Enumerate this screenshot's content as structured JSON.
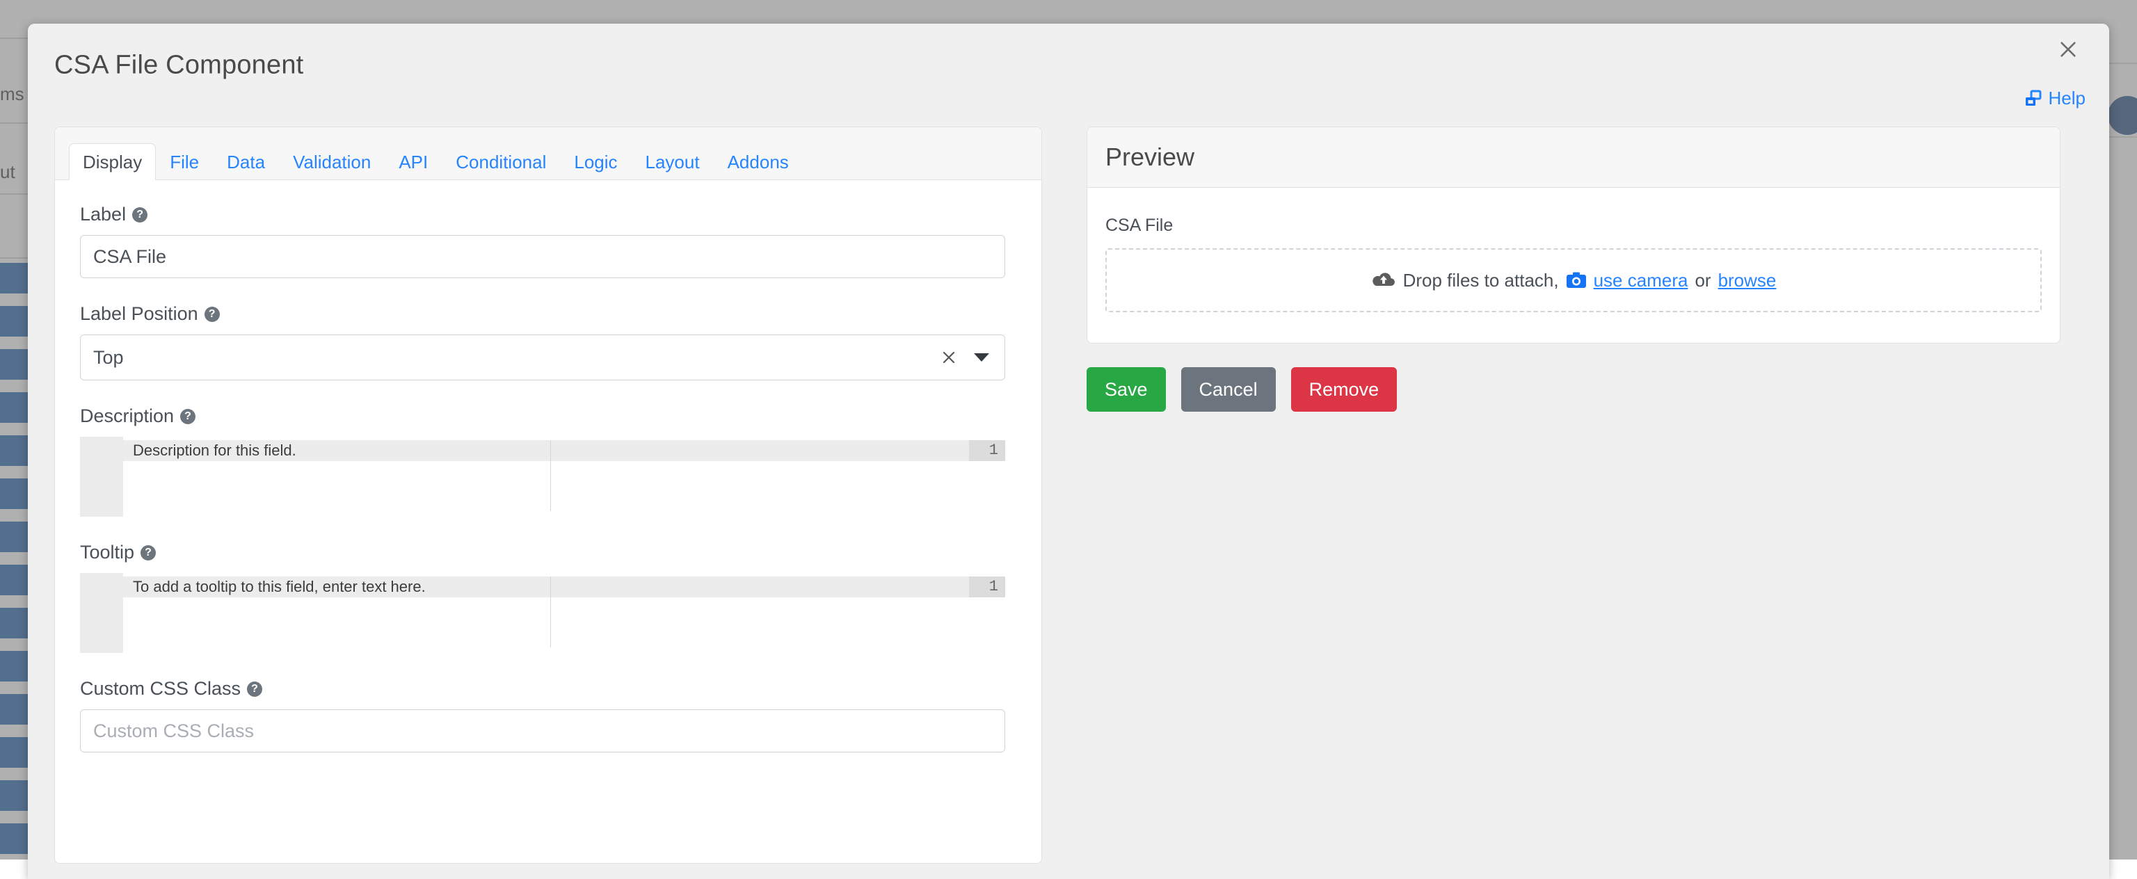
{
  "background": {
    "labels": [
      "ms",
      "ut"
    ],
    "blue_block_count": 9,
    "fab_icon": "circle-fab-icon"
  },
  "modal": {
    "title": "CSA File Component",
    "close_icon": "close-icon",
    "help": {
      "label": "Help",
      "icon": "help-windows-icon",
      "color": "#2684ff"
    }
  },
  "tabs": [
    {
      "label": "Display",
      "active": true
    },
    {
      "label": "File",
      "active": false
    },
    {
      "label": "Data",
      "active": false
    },
    {
      "label": "Validation",
      "active": false
    },
    {
      "label": "API",
      "active": false
    },
    {
      "label": "Conditional",
      "active": false
    },
    {
      "label": "Logic",
      "active": false
    },
    {
      "label": "Layout",
      "active": false
    },
    {
      "label": "Addons",
      "active": false
    }
  ],
  "form": {
    "label_field": {
      "label": "Label",
      "help_icon": "question-mark-icon",
      "value": "CSA File",
      "placeholder": "Label"
    },
    "label_position_field": {
      "label": "Label Position",
      "help_icon": "question-mark-icon",
      "value": "Top",
      "clear_icon": "clear-x-icon",
      "caret_icon": "chevron-down-icon"
    },
    "description_field": {
      "label": "Description",
      "help_icon": "question-mark-icon",
      "line_number": "1",
      "value": "Description for this field."
    },
    "tooltip_field": {
      "label": "Tooltip",
      "help_icon": "question-mark-icon",
      "line_number": "1",
      "value": "To add a tooltip to this field, enter text here."
    },
    "custom_css_field": {
      "label": "Custom CSS Class",
      "help_icon": "question-mark-icon",
      "value": "",
      "placeholder": "Custom CSS Class"
    }
  },
  "preview": {
    "title": "Preview",
    "field_label": "CSA File",
    "dropzone": {
      "cloud_icon": "cloud-upload-icon",
      "text_before": "Drop files to attach,",
      "camera_icon": "camera-icon",
      "camera_link": "use camera",
      "text_middle": "or",
      "browse_link": "browse"
    }
  },
  "actions": {
    "save": {
      "label": "Save",
      "color": "#28a745"
    },
    "cancel": {
      "label": "Cancel",
      "color": "#6c757d"
    },
    "remove": {
      "label": "Remove",
      "color": "#dc3545"
    }
  }
}
